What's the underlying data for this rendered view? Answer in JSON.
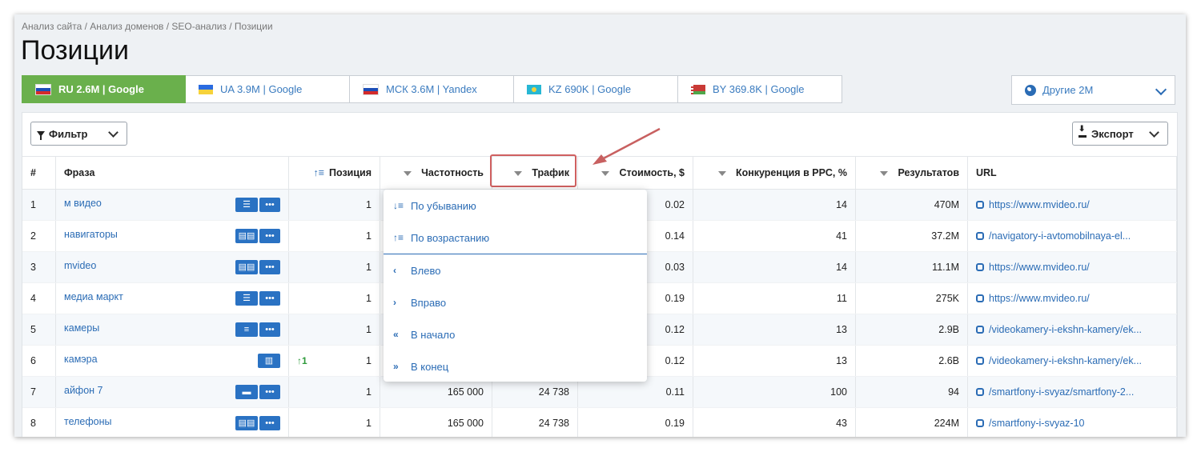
{
  "breadcrumb": "Анализ сайта / Анализ доменов / SEO-анализ / Позиции",
  "page_title": "Позиции",
  "tabs": [
    {
      "label": "RU 2.6M | Google",
      "flag": "ru",
      "active": true
    },
    {
      "label": "UA 3.9M | Google",
      "flag": "ua",
      "active": false
    },
    {
      "label": "МСК 3.6M | Yandex",
      "flag": "msk",
      "active": false
    },
    {
      "label": "KZ 690K | Google",
      "flag": "kz",
      "active": false
    },
    {
      "label": "BY 369.8K | Google",
      "flag": "by",
      "active": false
    }
  ],
  "other_select": {
    "label": "Другие 2M",
    "icon": "globe-icon"
  },
  "toolbar": {
    "filter_label": "Фильтр",
    "export_label": "Экспорт"
  },
  "columns": [
    "#",
    "Фраза",
    "Позиция",
    "Частотность",
    "Трафик",
    "Стоимость, $",
    "Конкуренция в PPC, %",
    "Результатов",
    "URL"
  ],
  "rows": [
    {
      "n": "1",
      "phrase": "м видео",
      "chips": [
        "list",
        "more"
      ],
      "change": "",
      "position": "1",
      "frequency": "",
      "traffic": "",
      "cost": "0.02",
      "competition": "14",
      "results": "470M",
      "url": "https://www.mvideo.ru/"
    },
    {
      "n": "2",
      "phrase": "навигаторы",
      "chips": [
        "cards",
        "more"
      ],
      "change": "",
      "position": "1",
      "frequency": "",
      "traffic": "",
      "cost": "0.14",
      "competition": "41",
      "results": "37.2M",
      "url": "/navigatory-i-avtomobilnaya-el..."
    },
    {
      "n": "3",
      "phrase": "mvideo",
      "chips": [
        "cards",
        "more"
      ],
      "change": "",
      "position": "1",
      "frequency": "",
      "traffic": "",
      "cost": "0.03",
      "competition": "14",
      "results": "11.1M",
      "url": "https://www.mvideo.ru/"
    },
    {
      "n": "4",
      "phrase": "медиа маркт",
      "chips": [
        "list",
        "more"
      ],
      "change": "",
      "position": "1",
      "frequency": "",
      "traffic": "",
      "cost": "0.19",
      "competition": "11",
      "results": "275K",
      "url": "https://www.mvideo.ru/"
    },
    {
      "n": "5",
      "phrase": "камеры",
      "chips": [
        "lines",
        "more"
      ],
      "change": "",
      "position": "1",
      "frequency": "",
      "traffic": "",
      "cost": "0.12",
      "competition": "13",
      "results": "2.9B",
      "url": "/videokamery-i-ekshn-kamery/ek..."
    },
    {
      "n": "6",
      "phrase": "камэра",
      "chips": [
        "book"
      ],
      "change": "1",
      "position": "1",
      "frequency": "",
      "traffic": "",
      "cost": "0.12",
      "competition": "13",
      "results": "2.6B",
      "url": "/videokamery-i-ekshn-kamery/ek..."
    },
    {
      "n": "7",
      "phrase": "айфон 7",
      "chips": [
        "chat",
        "more"
      ],
      "change": "",
      "position": "1",
      "frequency": "165 000",
      "traffic": "24 738",
      "cost": "0.11",
      "competition": "100",
      "results": "94",
      "url": "/smartfony-i-svyaz/smartfony-2..."
    },
    {
      "n": "8",
      "phrase": "телефоны",
      "chips": [
        "cards",
        "more"
      ],
      "change": "",
      "position": "1",
      "frequency": "165 000",
      "traffic": "24 738",
      "cost": "0.19",
      "competition": "43",
      "results": "224M",
      "url": "/smartfony-i-svyaz-10"
    }
  ],
  "sort_menu": {
    "items": [
      {
        "label": "По убыванию",
        "icon": "sort-desc-icon",
        "glyph": "↓≡"
      },
      {
        "label": "По возрастанию",
        "icon": "sort-asc-icon",
        "glyph": "↑≡"
      },
      {
        "label": "Влево",
        "icon": "chevron-left-icon",
        "glyph": "‹"
      },
      {
        "label": "Вправо",
        "icon": "chevron-right-icon",
        "glyph": "›"
      },
      {
        "label": "В начало",
        "icon": "double-chevron-left-icon",
        "glyph": "«"
      },
      {
        "label": "В конец",
        "icon": "double-chevron-right-icon",
        "glyph": "»"
      }
    ]
  },
  "colors": {
    "accent": "#2b6cb5",
    "active_tab": "#6ab04c",
    "highlight": "#d06060",
    "positive": "#2e9a3b"
  }
}
